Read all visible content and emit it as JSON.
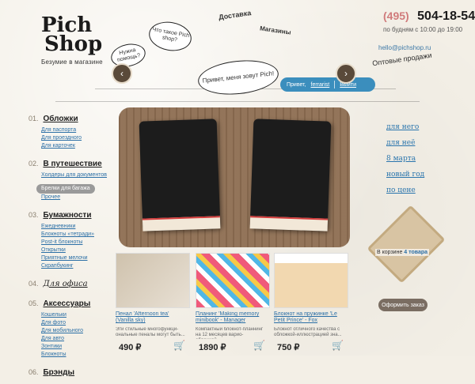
{
  "header": {
    "logo_line1": "Pich",
    "logo_line2": "Shop",
    "logo_tagline": "Безумие в магазине",
    "phone_code": "(495)",
    "phone_number": "504-18-54",
    "hours": "по будням с 10:00 до 19:00",
    "email": "hello@pichshop.ru",
    "wholesale": "Оптовые продажи",
    "speech_main": "Привет, меня зовут Pich!",
    "speech_what": "Что такое Pich shop?",
    "speech_help": "Нужна помощь?",
    "label_delivery": "Доставка",
    "label_shops": "Магазины",
    "welcome_prefix": "Привет,",
    "welcome_user": "ferrarist",
    "logout": "Выйти"
  },
  "nav": {
    "categories": [
      {
        "num": "01.",
        "title": "Обложки",
        "items": [
          "Для паспорта",
          "Для проездного",
          "Для карточек"
        ]
      },
      {
        "num": "02.",
        "title": "В путешествие",
        "items": [
          "Холдеры для документов",
          "Брелки для багажа",
          "Прочее"
        ],
        "active_index": 1
      },
      {
        "num": "03.",
        "title": "Бумажности",
        "items": [
          "Ежедневники",
          "Блокноты «тетради»",
          "Post-it блокноты",
          "Открытки",
          "Приятные мелочи",
          "Скрапбукинг"
        ]
      },
      {
        "num": "04.",
        "title": "Для офиса",
        "items": []
      },
      {
        "num": "05.",
        "title": "Аксессуары",
        "items": [
          "Кошельки",
          "Для фото",
          "Для мобильного",
          "Для авто",
          "Зонтики",
          "Блокноты"
        ]
      },
      {
        "num": "06.",
        "title": "Брэнды",
        "items": []
      }
    ]
  },
  "carousel": {
    "prev": "‹",
    "next": "›"
  },
  "right_links": [
    "для него",
    "для неё",
    "8 марта",
    "новый год",
    "по цене"
  ],
  "cart": {
    "prefix": "В корзине",
    "count": "4 товара",
    "order_button": "Оформить заказ"
  },
  "products": [
    {
      "name": "Пенал 'Afternoon tea' (Vanilla sky)",
      "desc": "Эти стильные многофункци-ональные пеналы могут быть...",
      "price": "490 ₽"
    },
    {
      "name": "Планинг 'Making memory minibook' - Manager",
      "desc": "Компактный блокнот-планнинг на 12 месяцев варио-обложкой...",
      "price": "1890 ₽"
    },
    {
      "name": "Блокнот на пружинке 'Le Petit Prince' - Fox",
      "desc": "Блокнот отличного качества с обложкой-иллюстрацией зна...",
      "price": "750 ₽"
    }
  ],
  "colors": {
    "accent_blue": "#3b8ebd",
    "link_blue": "#2b6fa6",
    "background": "#f3efe6"
  }
}
